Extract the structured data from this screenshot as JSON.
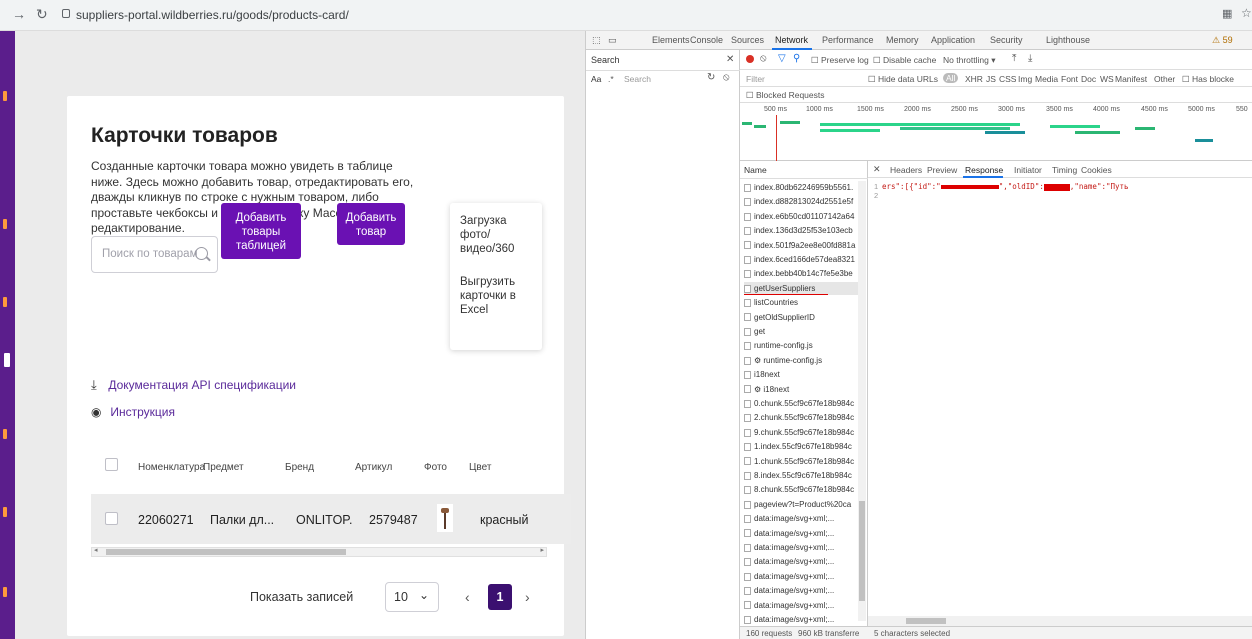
{
  "browser": {
    "url": "suppliers-portal.wildberries.ru/goods/products-card/"
  },
  "page": {
    "title": "Карточки товаров",
    "description": "Созданные карточки товара можно увидеть в таблице ниже. Здесь можно добавить товар, отредактировать его, дважды кликнув по строке с нужным товаром, либо проставьте чекбоксы и нажмите кнопку Массовое редактирование.",
    "search_placeholder": "Поиск по товарам",
    "btn_add_table": "Добавить товары таблицей",
    "btn_add_product": "Добавить товар",
    "dropdown": {
      "upload_media": "Загрузка фото/ видео/360",
      "export_excel": "Выгрузить карточки в Excel"
    },
    "api_doc_link": "Документация API спецификации",
    "instruction_link": "Инструкция",
    "table": {
      "headers": [
        "Номенклатура",
        "Предмет",
        "Бренд",
        "Артикул",
        "Фото",
        "Цвет"
      ],
      "row": {
        "nomenclature": "22060271",
        "subject": "Палки дл...",
        "brand": "ONLITOP.",
        "article": "2579487",
        "color": "красный"
      }
    },
    "pagination": {
      "show_label": "Показать записей",
      "page_size": "10",
      "current_page": "1"
    }
  },
  "devtools": {
    "tabs": [
      "Elements",
      "Console",
      "Sources",
      "Network",
      "Performance",
      "Memory",
      "Application",
      "Security",
      "Lighthouse"
    ],
    "active_tab": "Network",
    "warnings": "59",
    "search_tab": "Search",
    "search_placeholder": "Search",
    "aa_label": "Aa",
    "regex_label": ".*",
    "network_toolbar": {
      "preserve_log": "Preserve log",
      "disable_cache": "Disable cache",
      "throttling": "No throttling"
    },
    "filter_placeholder": "Filter",
    "filter_types": [
      "Hide data URLs",
      "All",
      "XHR",
      "JS",
      "CSS",
      "Img",
      "Media",
      "Font",
      "Doc",
      "WS",
      "Manifest",
      "Other",
      "Has blocke"
    ],
    "blocked_requests": "Blocked Requests",
    "timeline_labels": [
      "500 ms",
      "1000 ms",
      "1500 ms",
      "2000 ms",
      "2500 ms",
      "3000 ms",
      "3500 ms",
      "4000 ms",
      "4500 ms",
      "5000 ms",
      "550"
    ],
    "name_header": "Name",
    "requests": [
      "index.80db62246959b5561.",
      "index.d882813024d2551e5f",
      "index.e6b50cd01107142a64",
      "index.136d3d25f53e103ecb",
      "index.501f9a2ee8e00fd881a",
      "index.6ced166de57dea8321",
      "index.bebb40b14c7fe5e3be",
      "getUserSuppliers",
      "listCountries",
      "getOldSupplierID",
      "get",
      "runtime-config.js",
      "⚙ runtime-config.js",
      "i18next",
      "⚙ i18next",
      "0.chunk.55cf9c67fe18b984c",
      "2.chunk.55cf9c67fe18b984c",
      "9.chunk.55cf9c67fe18b984c",
      "1.index.55cf9c67fe18b984c",
      "1.chunk.55cf9c67fe18b984c",
      "8.index.55cf9c67fe18b984c",
      "8.chunk.55cf9c67fe18b984c",
      "pageview?t=Product%20ca",
      "data:image/svg+xml;...",
      "data:image/svg+xml;...",
      "data:image/svg+xml;...",
      "data:image/svg+xml;...",
      "data:image/svg+xml;...",
      "data:image/svg+xml;...",
      "data:image/svg+xml;...",
      "data:image/svg+xml;..."
    ],
    "selected_request": "getUserSuppliers",
    "response_tabs": [
      "Headers",
      "Preview",
      "Response",
      "Initiator",
      "Timing",
      "Cookies"
    ],
    "active_response_tab": "Response",
    "response_line1_a": "ers\":[{\"id\":\"",
    "response_line1_b": "\",\"oldID\":",
    "response_line1_c": ",\"name\":\"Путь",
    "line_numbers": [
      "1",
      "2"
    ],
    "status": {
      "requests": "160 requests",
      "transferred": "960 kB transferre",
      "selection": "5 characters selected"
    }
  }
}
